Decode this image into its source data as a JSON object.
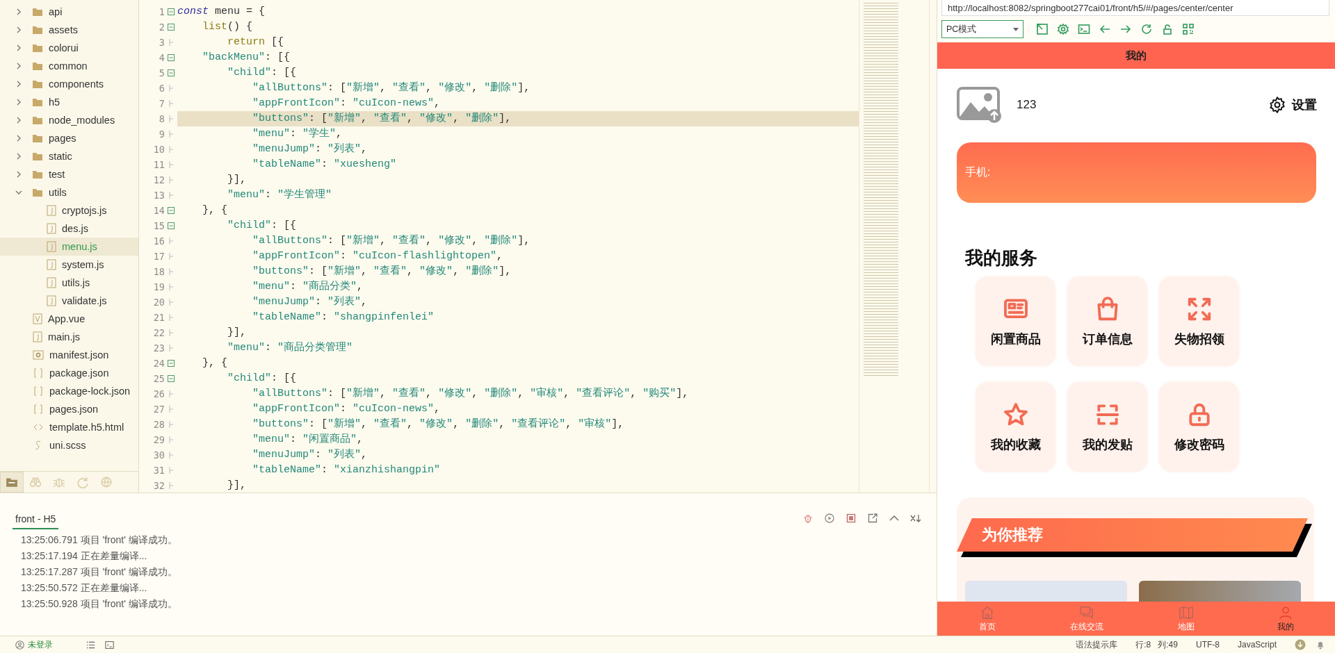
{
  "file_tree": {
    "items": [
      {
        "label": "api",
        "kind": "folder",
        "expanded": false,
        "selected": false
      },
      {
        "label": "assets",
        "kind": "folder",
        "expanded": false,
        "selected": false
      },
      {
        "label": "colorui",
        "kind": "folder",
        "expanded": false,
        "selected": false
      },
      {
        "label": "common",
        "kind": "folder",
        "expanded": false,
        "selected": false
      },
      {
        "label": "components",
        "kind": "folder",
        "expanded": false,
        "selected": false
      },
      {
        "label": "h5",
        "kind": "folder",
        "expanded": false,
        "selected": false
      },
      {
        "label": "node_modules",
        "kind": "folder",
        "expanded": false,
        "selected": false
      },
      {
        "label": "pages",
        "kind": "folder",
        "expanded": false,
        "selected": false
      },
      {
        "label": "static",
        "kind": "folder",
        "expanded": false,
        "selected": false
      },
      {
        "label": "test",
        "kind": "folder",
        "expanded": false,
        "selected": false
      },
      {
        "label": "utils",
        "kind": "folder",
        "expanded": true,
        "selected": false,
        "children": [
          {
            "label": "cryptojs.js",
            "kind": "js",
            "selected": false
          },
          {
            "label": "des.js",
            "kind": "js",
            "selected": false
          },
          {
            "label": "menu.js",
            "kind": "js",
            "selected": true
          },
          {
            "label": "system.js",
            "kind": "js",
            "selected": false
          },
          {
            "label": "utils.js",
            "kind": "js",
            "selected": false
          },
          {
            "label": "validate.js",
            "kind": "js",
            "selected": false
          }
        ]
      },
      {
        "label": "App.vue",
        "kind": "vue",
        "selected": false
      },
      {
        "label": "main.js",
        "kind": "js",
        "selected": false
      },
      {
        "label": "manifest.json",
        "kind": "manifest",
        "selected": false
      },
      {
        "label": "package.json",
        "kind": "json",
        "selected": false
      },
      {
        "label": "package-lock.json",
        "kind": "json",
        "selected": false
      },
      {
        "label": "pages.json",
        "kind": "json",
        "selected": false
      },
      {
        "label": "template.h5.html",
        "kind": "html",
        "selected": false
      },
      {
        "label": "uni.scss",
        "kind": "scss",
        "selected": false
      }
    ]
  },
  "sidebar_tabs": [
    {
      "kind": "files",
      "selected": true
    },
    {
      "kind": "binoculars",
      "selected": false
    },
    {
      "kind": "bug",
      "selected": false
    },
    {
      "kind": "update",
      "selected": false
    },
    {
      "kind": "globe",
      "selected": false
    }
  ],
  "editor": {
    "lines": [
      {
        "number": "1",
        "foldable": true,
        "current": false,
        "tokens": [
          {
            "kind": "keyword",
            "text": "const"
          },
          {
            "kind": "plain",
            "text": " menu = {"
          }
        ]
      },
      {
        "number": "2",
        "foldable": true,
        "current": false,
        "tokens": [
          {
            "kind": "builtin",
            "text": "    list"
          },
          {
            "kind": "plain",
            "text": "() {"
          }
        ]
      },
      {
        "number": "3",
        "foldable": false,
        "current": false,
        "tokens": [
          {
            "kind": "builtin",
            "text": "        return"
          },
          {
            "kind": "plain",
            "text": " [{"
          }
        ]
      },
      {
        "number": "4",
        "foldable": true,
        "current": false,
        "tokens": [
          {
            "kind": "string",
            "text": "    \"backMenu\""
          },
          {
            "kind": "plain",
            "text": ": [{"
          }
        ]
      },
      {
        "number": "5",
        "foldable": true,
        "current": false,
        "tokens": [
          {
            "kind": "string",
            "text": "        \"child\""
          },
          {
            "kind": "plain",
            "text": ": [{"
          }
        ]
      },
      {
        "number": "6",
        "foldable": false,
        "current": false,
        "tokens": [
          {
            "kind": "string",
            "text": "            \"allButtons\""
          },
          {
            "kind": "plain",
            "text": ": ["
          },
          {
            "kind": "string",
            "text": "\"新增\""
          },
          {
            "kind": "plain",
            "text": ", "
          },
          {
            "kind": "string",
            "text": "\"查看\""
          },
          {
            "kind": "plain",
            "text": ", "
          },
          {
            "kind": "string",
            "text": "\"修改\""
          },
          {
            "kind": "plain",
            "text": ", "
          },
          {
            "kind": "string",
            "text": "\"删除\""
          },
          {
            "kind": "plain",
            "text": "],"
          }
        ]
      },
      {
        "number": "7",
        "foldable": false,
        "current": false,
        "tokens": [
          {
            "kind": "string",
            "text": "            \"appFrontIcon\""
          },
          {
            "kind": "plain",
            "text": ": "
          },
          {
            "kind": "string",
            "text": "\"cuIcon-news\""
          },
          {
            "kind": "plain",
            "text": ","
          }
        ]
      },
      {
        "number": "8",
        "foldable": false,
        "current": true,
        "tokens": [
          {
            "kind": "string",
            "text": "            \"buttons\""
          },
          {
            "kind": "plain",
            "text": ": ["
          },
          {
            "kind": "string",
            "text": "\"新增\""
          },
          {
            "kind": "plain",
            "text": ", "
          },
          {
            "kind": "string",
            "text": "\"查看\""
          },
          {
            "kind": "plain",
            "text": ", "
          },
          {
            "kind": "string",
            "text": "\"修改\""
          },
          {
            "kind": "plain",
            "text": ", "
          },
          {
            "kind": "string",
            "text": "\"删除\""
          },
          {
            "kind": "plain",
            "text": "],"
          }
        ]
      },
      {
        "number": "9",
        "foldable": false,
        "current": false,
        "tokens": [
          {
            "kind": "string",
            "text": "            \"menu\""
          },
          {
            "kind": "plain",
            "text": ": "
          },
          {
            "kind": "string",
            "text": "\"学生\""
          },
          {
            "kind": "plain",
            "text": ","
          }
        ]
      },
      {
        "number": "10",
        "foldable": false,
        "current": false,
        "tokens": [
          {
            "kind": "string",
            "text": "            \"menuJump\""
          },
          {
            "kind": "plain",
            "text": ": "
          },
          {
            "kind": "string",
            "text": "\"列表\""
          },
          {
            "kind": "plain",
            "text": ","
          }
        ]
      },
      {
        "number": "11",
        "foldable": false,
        "current": false,
        "tokens": [
          {
            "kind": "string",
            "text": "            \"tableName\""
          },
          {
            "kind": "plain",
            "text": ": "
          },
          {
            "kind": "string",
            "text": "\"xuesheng\""
          }
        ]
      },
      {
        "number": "12",
        "foldable": false,
        "current": false,
        "tokens": [
          {
            "kind": "plain",
            "text": "        }],"
          }
        ]
      },
      {
        "number": "13",
        "foldable": false,
        "current": false,
        "tokens": [
          {
            "kind": "string",
            "text": "        \"menu\""
          },
          {
            "kind": "plain",
            "text": ": "
          },
          {
            "kind": "string",
            "text": "\"学生管理\""
          }
        ]
      },
      {
        "number": "14",
        "foldable": true,
        "current": false,
        "tokens": [
          {
            "kind": "plain",
            "text": "    }, {"
          }
        ]
      },
      {
        "number": "15",
        "foldable": true,
        "current": false,
        "tokens": [
          {
            "kind": "string",
            "text": "        \"child\""
          },
          {
            "kind": "plain",
            "text": ": [{"
          }
        ]
      },
      {
        "number": "16",
        "foldable": false,
        "current": false,
        "tokens": [
          {
            "kind": "string",
            "text": "            \"allButtons\""
          },
          {
            "kind": "plain",
            "text": ": ["
          },
          {
            "kind": "string",
            "text": "\"新增\""
          },
          {
            "kind": "plain",
            "text": ", "
          },
          {
            "kind": "string",
            "text": "\"查看\""
          },
          {
            "kind": "plain",
            "text": ", "
          },
          {
            "kind": "string",
            "text": "\"修改\""
          },
          {
            "kind": "plain",
            "text": ", "
          },
          {
            "kind": "string",
            "text": "\"删除\""
          },
          {
            "kind": "plain",
            "text": "],"
          }
        ]
      },
      {
        "number": "17",
        "foldable": false,
        "current": false,
        "tokens": [
          {
            "kind": "string",
            "text": "            \"appFrontIcon\""
          },
          {
            "kind": "plain",
            "text": ": "
          },
          {
            "kind": "string",
            "text": "\"cuIcon-flashlightopen\""
          },
          {
            "kind": "plain",
            "text": ","
          }
        ]
      },
      {
        "number": "18",
        "foldable": false,
        "current": false,
        "tokens": [
          {
            "kind": "string",
            "text": "            \"buttons\""
          },
          {
            "kind": "plain",
            "text": ": ["
          },
          {
            "kind": "string",
            "text": "\"新增\""
          },
          {
            "kind": "plain",
            "text": ", "
          },
          {
            "kind": "string",
            "text": "\"查看\""
          },
          {
            "kind": "plain",
            "text": ", "
          },
          {
            "kind": "string",
            "text": "\"修改\""
          },
          {
            "kind": "plain",
            "text": ", "
          },
          {
            "kind": "string",
            "text": "\"删除\""
          },
          {
            "kind": "plain",
            "text": "],"
          }
        ]
      },
      {
        "number": "19",
        "foldable": false,
        "current": false,
        "tokens": [
          {
            "kind": "string",
            "text": "            \"menu\""
          },
          {
            "kind": "plain",
            "text": ": "
          },
          {
            "kind": "string",
            "text": "\"商品分类\""
          },
          {
            "kind": "plain",
            "text": ","
          }
        ]
      },
      {
        "number": "20",
        "foldable": false,
        "current": false,
        "tokens": [
          {
            "kind": "string",
            "text": "            \"menuJump\""
          },
          {
            "kind": "plain",
            "text": ": "
          },
          {
            "kind": "string",
            "text": "\"列表\""
          },
          {
            "kind": "plain",
            "text": ","
          }
        ]
      },
      {
        "number": "21",
        "foldable": false,
        "current": false,
        "tokens": [
          {
            "kind": "string",
            "text": "            \"tableName\""
          },
          {
            "kind": "plain",
            "text": ": "
          },
          {
            "kind": "string",
            "text": "\"shangpinfenlei\""
          }
        ]
      },
      {
        "number": "22",
        "foldable": false,
        "current": false,
        "tokens": [
          {
            "kind": "plain",
            "text": "        }],"
          }
        ]
      },
      {
        "number": "23",
        "foldable": false,
        "current": false,
        "tokens": [
          {
            "kind": "string",
            "text": "        \"menu\""
          },
          {
            "kind": "plain",
            "text": ": "
          },
          {
            "kind": "string",
            "text": "\"商品分类管理\""
          }
        ]
      },
      {
        "number": "24",
        "foldable": true,
        "current": false,
        "tokens": [
          {
            "kind": "plain",
            "text": "    }, {"
          }
        ]
      },
      {
        "number": "25",
        "foldable": true,
        "current": false,
        "tokens": [
          {
            "kind": "string",
            "text": "        \"child\""
          },
          {
            "kind": "plain",
            "text": ": [{"
          }
        ]
      },
      {
        "number": "26",
        "foldable": false,
        "current": false,
        "tokens": [
          {
            "kind": "string",
            "text": "            \"allButtons\""
          },
          {
            "kind": "plain",
            "text": ": ["
          },
          {
            "kind": "string",
            "text": "\"新增\""
          },
          {
            "kind": "plain",
            "text": ", "
          },
          {
            "kind": "string",
            "text": "\"查看\""
          },
          {
            "kind": "plain",
            "text": ", "
          },
          {
            "kind": "string",
            "text": "\"修改\""
          },
          {
            "kind": "plain",
            "text": ", "
          },
          {
            "kind": "string",
            "text": "\"删除\""
          },
          {
            "kind": "plain",
            "text": ", "
          },
          {
            "kind": "string",
            "text": "\"审核\""
          },
          {
            "kind": "plain",
            "text": ", "
          },
          {
            "kind": "string",
            "text": "\"查看评论\""
          },
          {
            "kind": "plain",
            "text": ", "
          },
          {
            "kind": "string",
            "text": "\"购买\""
          },
          {
            "kind": "plain",
            "text": "],"
          }
        ]
      },
      {
        "number": "27",
        "foldable": false,
        "current": false,
        "tokens": [
          {
            "kind": "string",
            "text": "            \"appFrontIcon\""
          },
          {
            "kind": "plain",
            "text": ": "
          },
          {
            "kind": "string",
            "text": "\"cuIcon-news\""
          },
          {
            "kind": "plain",
            "text": ","
          }
        ]
      },
      {
        "number": "28",
        "foldable": false,
        "current": false,
        "tokens": [
          {
            "kind": "string",
            "text": "            \"buttons\""
          },
          {
            "kind": "plain",
            "text": ": ["
          },
          {
            "kind": "string",
            "text": "\"新增\""
          },
          {
            "kind": "plain",
            "text": ", "
          },
          {
            "kind": "string",
            "text": "\"查看\""
          },
          {
            "kind": "plain",
            "text": ", "
          },
          {
            "kind": "string",
            "text": "\"修改\""
          },
          {
            "kind": "plain",
            "text": ", "
          },
          {
            "kind": "string",
            "text": "\"删除\""
          },
          {
            "kind": "plain",
            "text": ", "
          },
          {
            "kind": "string",
            "text": "\"查看评论\""
          },
          {
            "kind": "plain",
            "text": ", "
          },
          {
            "kind": "string",
            "text": "\"审核\""
          },
          {
            "kind": "plain",
            "text": "],"
          }
        ]
      },
      {
        "number": "29",
        "foldable": false,
        "current": false,
        "tokens": [
          {
            "kind": "string",
            "text": "            \"menu\""
          },
          {
            "kind": "plain",
            "text": ": "
          },
          {
            "kind": "string",
            "text": "\"闲置商品\""
          },
          {
            "kind": "plain",
            "text": ","
          }
        ]
      },
      {
        "number": "30",
        "foldable": false,
        "current": false,
        "tokens": [
          {
            "kind": "string",
            "text": "            \"menuJump\""
          },
          {
            "kind": "plain",
            "text": ": "
          },
          {
            "kind": "string",
            "text": "\"列表\""
          },
          {
            "kind": "plain",
            "text": ","
          }
        ]
      },
      {
        "number": "31",
        "foldable": false,
        "current": false,
        "tokens": [
          {
            "kind": "string",
            "text": "            \"tableName\""
          },
          {
            "kind": "plain",
            "text": ": "
          },
          {
            "kind": "string",
            "text": "\"xianzhishangpin\""
          }
        ]
      },
      {
        "number": "32",
        "foldable": false,
        "current": false,
        "tokens": [
          {
            "kind": "plain",
            "text": "        }],"
          }
        ]
      }
    ]
  },
  "console": {
    "tab": {
      "label": "front - H5",
      "selected": true
    },
    "log": [
      "13:25:06.791 项目 'front' 编译成功。",
      "13:25:17.194 正在差量编译...",
      "13:25:17.287 项目 'front' 编译成功。",
      "13:25:50.572 正在差量编译...",
      "13:25:50.928 项目 'front' 编译成功。"
    ]
  },
  "preview": {
    "url": "http://localhost:8082/springboot277cai01/front/h5/#/pages/center/center",
    "mode": "PC模式",
    "header_title": "我的",
    "profile": {
      "name": "123",
      "settings": "设置"
    },
    "phone_card": {
      "label": "手机:"
    },
    "services_title": "我的服务",
    "services": [
      {
        "label": "闲置商品",
        "kind": "news"
      },
      {
        "label": "订单信息",
        "kind": "bag"
      },
      {
        "label": "失物招领",
        "kind": "expand"
      },
      {
        "label": "我的收藏",
        "kind": "star"
      },
      {
        "label": "我的发贴",
        "kind": "scan"
      },
      {
        "label": "修改密码",
        "kind": "lock"
      }
    ],
    "recommend_title": "为你推荐",
    "nav": [
      {
        "label": "首页",
        "kind": "home",
        "selected": false
      },
      {
        "label": "在线交流",
        "kind": "chat",
        "selected": false
      },
      {
        "label": "地图",
        "kind": "map",
        "selected": false
      },
      {
        "label": "我的",
        "kind": "person",
        "selected": true
      }
    ]
  },
  "status_bar": {
    "login": "未登录",
    "right": [
      "语法提示库",
      "行:8",
      "列:49",
      "UTF-8",
      "JavaScript"
    ]
  }
}
